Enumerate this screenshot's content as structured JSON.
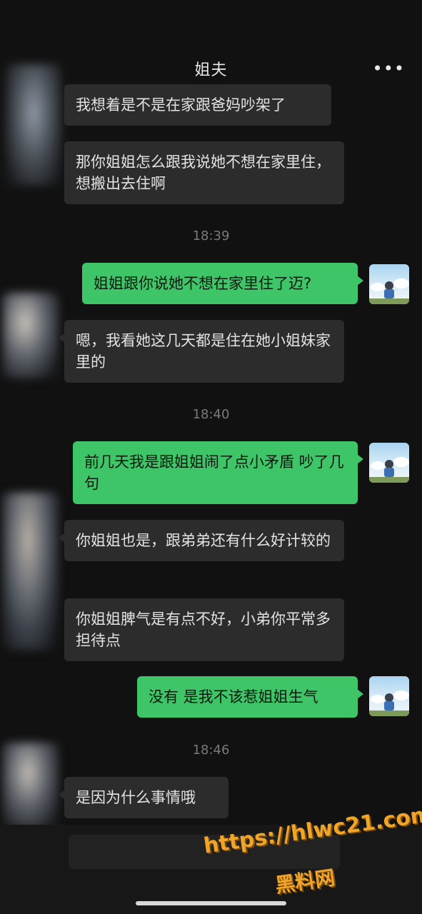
{
  "header": {
    "title": "姐夫",
    "more_icon": "more-icon",
    "more_glyph": "•••"
  },
  "messages": [
    {
      "dir": "in",
      "text": "我想着是不是在家跟爸妈吵架了"
    },
    {
      "dir": "in",
      "text": "那你姐姐怎么跟我说她不想在家里住，想搬出去住啊"
    },
    {
      "dir": "time",
      "text": "18:39"
    },
    {
      "dir": "out",
      "text": "姐姐跟你说她不想在家里住了迈?"
    },
    {
      "dir": "in",
      "text": "嗯，我看她这几天都是住在她小姐妹家里的"
    },
    {
      "dir": "time",
      "text": "18:40"
    },
    {
      "dir": "out",
      "text": "前几天我是跟姐姐闹了点小矛盾 吵了几句"
    },
    {
      "dir": "in",
      "text": "你姐姐也是，跟弟弟还有什么好计较的"
    },
    {
      "dir": "in",
      "text": "你姐姐脾气是有点不好，小弟你平常多担待点"
    },
    {
      "dir": "out",
      "text": "没有 是我不该惹姐姐生气"
    },
    {
      "dir": "time",
      "text": "18:46"
    },
    {
      "dir": "in",
      "text": "是因为什么事情哦"
    }
  ],
  "watermark": {
    "url": "https://hlwc21.com",
    "name": "黑料网"
  },
  "colors": {
    "background": "#111111",
    "bubble_in": "#2c2c2c",
    "bubble_out": "#3dc567",
    "timestamp": "#7a7a7a",
    "watermark": "#f0a52a"
  }
}
